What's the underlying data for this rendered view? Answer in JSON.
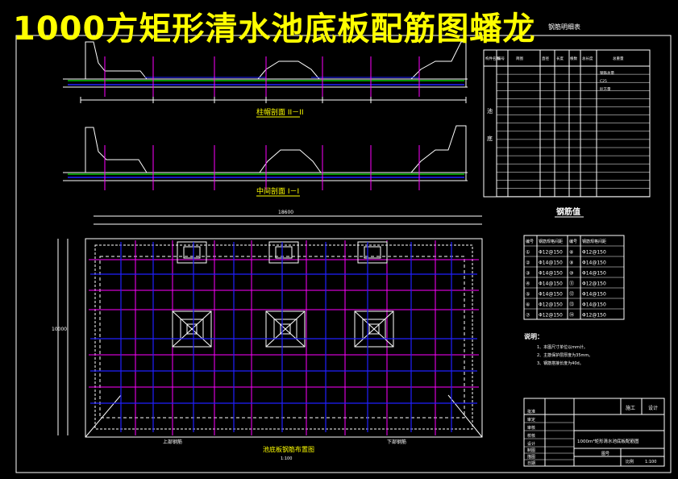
{
  "title": "1000方矩形清水池底板配筋图蟠龙",
  "drawing": {
    "section_top_label": "柱帽剖面 II－II",
    "section_mid_label": "中间剖面 I－I",
    "plan_label": "池底板钢筋布置图",
    "plan_scale": "1:100",
    "left_corner_label": "上部钢筋",
    "right_corner_label": "下部钢筋",
    "top_overall_dim": "18600",
    "left_overall_dim": "10000"
  },
  "rebar_table": {
    "title": "钢筋明细表",
    "headers": [
      "构件名称",
      "编号",
      "简图",
      "直径",
      "长度",
      "根数",
      "总长度",
      "总重量"
    ],
    "rows_1": [
      "池",
      "底"
    ],
    "notes": [
      "钢筋总量",
      "C25",
      "砼方量"
    ]
  },
  "rebar_value_table": {
    "title": "钢筋值",
    "headers": [
      "编号",
      "钢筋规格间距",
      "编号",
      "钢筋规格间距"
    ],
    "rows": [
      [
        "①",
        "Φ12@150",
        "⑧",
        "Φ12@150"
      ],
      [
        "②",
        "Φ14@150",
        "⑨",
        "Φ14@150"
      ],
      [
        "③",
        "Φ14@150",
        "⑩",
        "Φ14@150"
      ],
      [
        "④",
        "Φ14@150",
        "⑪",
        "Φ12@150"
      ],
      [
        "⑤",
        "Φ14@150",
        "⑫",
        "Φ14@150"
      ],
      [
        "⑥",
        "Φ12@150",
        "⑬",
        "Φ14@150"
      ],
      [
        "⑦",
        "Φ12@150",
        "⑭",
        "Φ12@150"
      ]
    ]
  },
  "notes": {
    "heading": "说明：",
    "items": [
      "1、本图尺寸单位以mm计。",
      "2、主筋保护层厚度为35mm。",
      "3、钢筋搭接长度为40d。"
    ]
  },
  "title_block": {
    "stage_1": "施工",
    "stage_2": "设计",
    "rows": [
      "批准",
      "审定",
      "审核",
      "校核",
      "设计",
      "制图",
      "描图",
      "日期"
    ],
    "drawing_name": "1000m³矩形清水池底板配筋图",
    "sheet_label": "图号",
    "scale_label": "比例",
    "ratio": "1:100"
  },
  "colors": {
    "background": "#000000",
    "title": "#ffff00",
    "line_white": "#ffffff",
    "grid_magenta": "#ff00ff",
    "rebar_blue": "#2020ff",
    "rebar_green": "#00c000"
  }
}
